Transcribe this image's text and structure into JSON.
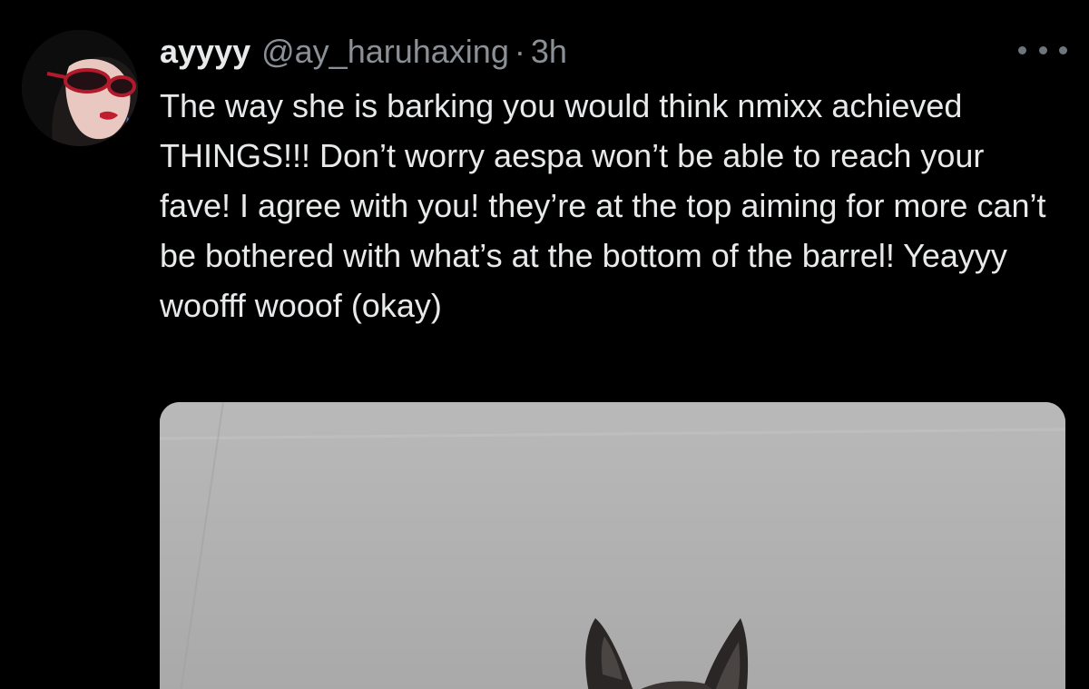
{
  "tweet": {
    "author": {
      "display_name": "ayyyy",
      "handle": "@ay_haruhaxing",
      "avatar_icon": "profile-photo-woman-glasses"
    },
    "separator": "·",
    "timestamp": "3h",
    "more_icon": "ellipsis-icon",
    "text": "The way she is barking you would think nmixx achieved THINGS!!! Don’t worry aespa won’t be able to reach your fave! I agree with you! they’re at the top aiming for more can’t be bothered with what’s at the bottom of the barrel! Yeayyy woofff wooof (okay)",
    "media": {
      "description_icon": "dog-ears-photo"
    }
  },
  "colors": {
    "background": "#000000",
    "text_primary": "#e7e9ea",
    "text_secondary": "#8b9096",
    "media_background": "#b3b3b3"
  }
}
